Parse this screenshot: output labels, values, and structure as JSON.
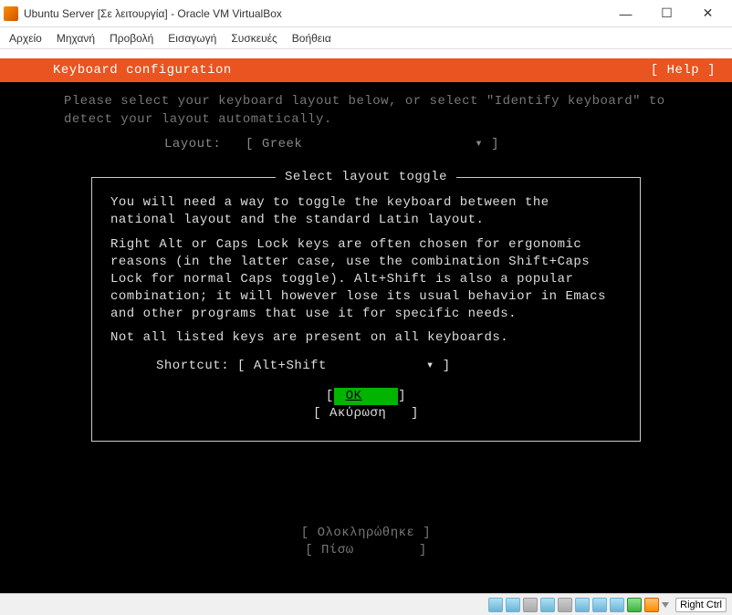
{
  "window": {
    "title": "Ubuntu Server [Σε λειτουργία] - Oracle VM VirtualBox"
  },
  "menu": {
    "file": "Αρχείο",
    "machine": "Μηχανή",
    "view": "Προβολή",
    "input": "Εισαγωγή",
    "devices": "Συσκευές",
    "help": "Βοήθεια"
  },
  "installer": {
    "header_title": "Keyboard configuration",
    "help_label": "[ Help ]",
    "instructions": "Please select your keyboard layout below, or select \"Identify keyboard\" to detect your layout automatically.",
    "layout_label": "Layout:",
    "layout_value": "Greek",
    "dropdown_caret": "▾",
    "dialog": {
      "title": "Select layout toggle",
      "p1": "You will need a way to toggle the keyboard between the national layout and the standard Latin layout.",
      "p2": "Right Alt or Caps Lock keys are often chosen for ergonomic reasons (in the latter case, use the combination Shift+Caps Lock for normal Caps toggle). Alt+Shift is also a popular combination; it will however lose its usual behavior in Emacs and other programs that use it for specific needs.",
      "p3": "Not all listed keys are present on all keyboards.",
      "shortcut_label": "Shortcut:",
      "shortcut_value": "Alt+Shift",
      "ok_label": "OK",
      "cancel_label": "Ακύρωση"
    },
    "footer": {
      "done": "Ολοκληρώθηκε",
      "back": "Πίσω"
    }
  },
  "statusbar": {
    "host_key": "Right Ctrl"
  }
}
